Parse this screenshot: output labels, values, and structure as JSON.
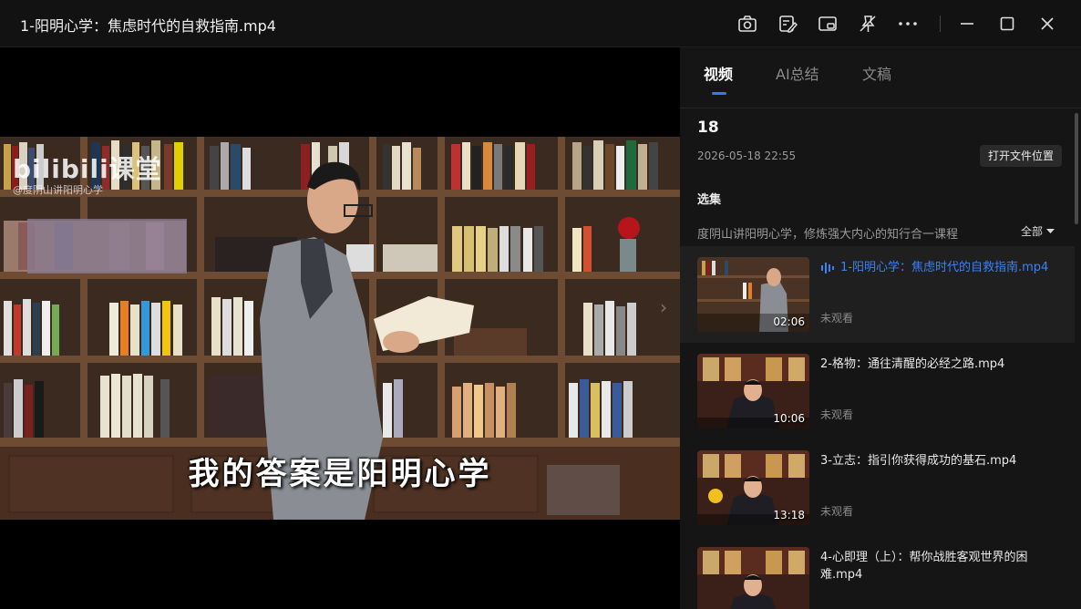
{
  "window": {
    "title": "1-阳明心学：焦虑时代的自救指南.mp4"
  },
  "toolbar": {
    "icons": [
      "camera-icon",
      "edit-note-icon",
      "picture-in-picture-icon",
      "pin-off-icon",
      "more-icon"
    ],
    "window_controls": [
      "minimize-icon",
      "maximize-icon",
      "close-icon"
    ]
  },
  "video": {
    "watermark_logo": "bilibili课堂",
    "watermark_sub": "@度阴山讲阳明心学",
    "subtitle": "我的答案是阳明心学"
  },
  "panel": {
    "tabs": [
      {
        "label": "视频",
        "active": true
      },
      {
        "label": "AI总结",
        "active": false
      },
      {
        "label": "文稿",
        "active": false
      }
    ],
    "count": "18",
    "date": "2026-05-18 22:55",
    "open_location_label": "打开文件位置",
    "section_title": "选集",
    "series_desc": "度阴山讲阳明心学，修炼强大内心的知行合一课程",
    "filter_label": "全部",
    "episodes": [
      {
        "title": "1-阳明心学：焦虑时代的自救指南.mp4",
        "duration": "02:06",
        "status": "未观看",
        "active": true
      },
      {
        "title": "2-格物：通往清醒的必经之路.mp4",
        "duration": "10:06",
        "status": "未观看",
        "active": false
      },
      {
        "title": "3-立志：指引你获得成功的基石.mp4",
        "duration": "13:18",
        "status": "未观看",
        "active": false
      },
      {
        "title": "4-心即理（上）：帮你战胜客观世界的困难.mp4",
        "duration": "",
        "status": "",
        "active": false
      }
    ]
  },
  "colors": {
    "accent": "#3b82f6",
    "background": "#121212",
    "panel": "#151515"
  }
}
